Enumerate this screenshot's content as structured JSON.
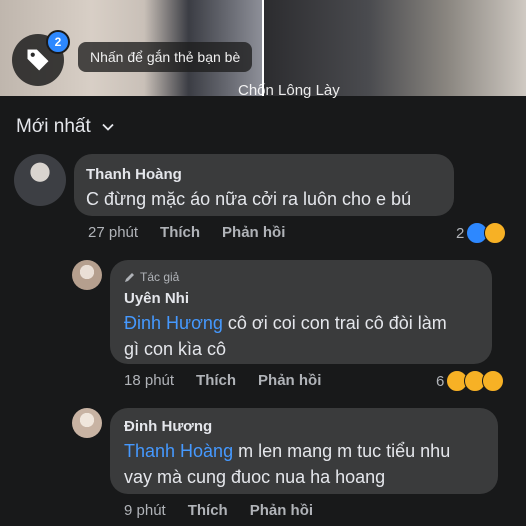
{
  "photo": {
    "tag_badge_count": "2",
    "tag_prompt": "Nhấn để gắn thẻ bạn bè",
    "watermark": "Chốn Lông Lày"
  },
  "sort": {
    "label": "Mới nhất"
  },
  "comments": [
    {
      "name": "Thanh Hoàng",
      "text": "C đừng mặc áo nữa cởi ra luôn cho e bú",
      "time": "27 phút",
      "like": "Thích",
      "reply": "Phản hồi",
      "reaction_count": "2",
      "reactions": [
        "like",
        "sad"
      ]
    },
    {
      "author_badge": "Tác giả",
      "name": "Uyên Nhi",
      "mention": "Đinh Hương",
      "text_line1": " cô ơi coi con trai cô đòi làm",
      "text_line2": "gì con kìa cô",
      "time": "18 phút",
      "like": "Thích",
      "reply": "Phản hồi",
      "reaction_count": "6",
      "reactions": [
        "haha",
        "wow",
        "sad"
      ]
    },
    {
      "name": "Đinh Hương",
      "mention": "Thanh Hoàng",
      "text_line1": " m len mang m tuc tiểu nhu",
      "text_line2": "vay mà cung đuoc nua ha hoang",
      "time": "9 phút",
      "like": "Thích",
      "reply": "Phản hồi"
    }
  ],
  "colors": {
    "background": "#18191a",
    "bubble": "#3a3b3c",
    "mention": "#4599ff",
    "meta": "#b0b3b8",
    "accent": "#2d88ff"
  }
}
